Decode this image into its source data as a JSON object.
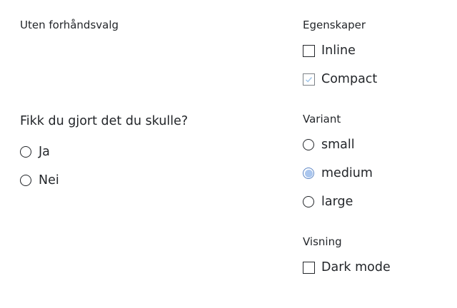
{
  "demo": {
    "heading": "Uten forhåndsvalg",
    "question": "Fikk du gjort det du skulle?",
    "options": [
      {
        "label": "Ja",
        "selected": false
      },
      {
        "label": "Nei",
        "selected": false
      }
    ]
  },
  "settings": {
    "properties": {
      "legend": "Egenskaper",
      "items": [
        {
          "label": "Inline",
          "checked": false
        },
        {
          "label": "Compact",
          "checked": true
        }
      ]
    },
    "variant": {
      "legend": "Variant",
      "options": [
        {
          "label": "small",
          "selected": false
        },
        {
          "label": "medium",
          "selected": true
        },
        {
          "label": "large",
          "selected": false
        }
      ]
    },
    "display": {
      "legend": "Visning",
      "items": [
        {
          "label": "Dark mode",
          "checked": false
        }
      ]
    }
  },
  "colors": {
    "text": "#23262a",
    "radio_selected_fill": "#aac6ee",
    "radio_selected_border": "#5a84c4",
    "checkbox_tick": "#9fc4e8"
  }
}
